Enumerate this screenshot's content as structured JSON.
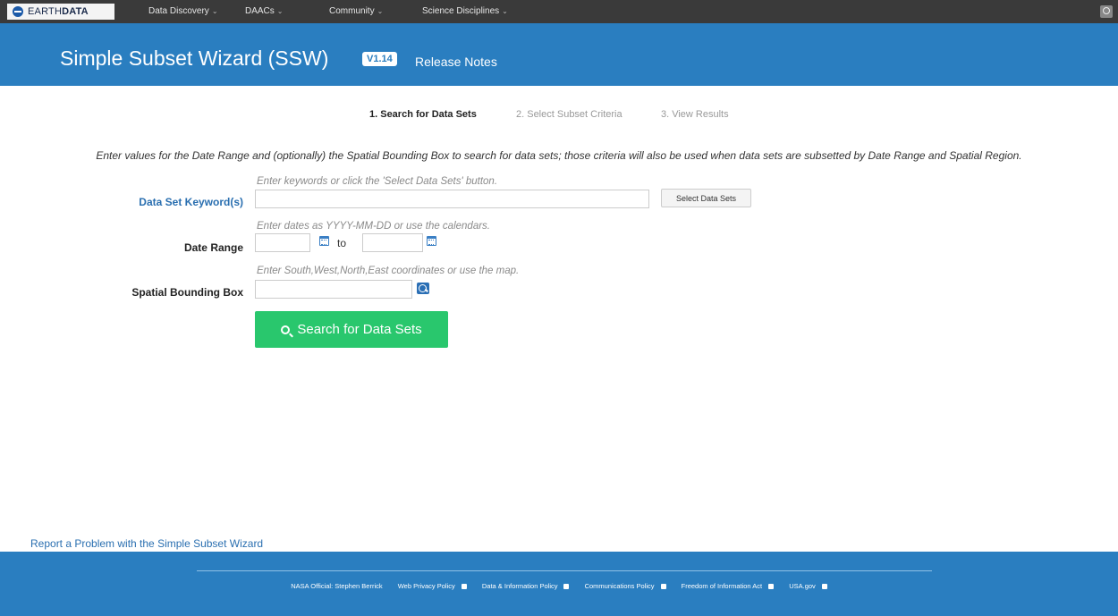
{
  "topnav": {
    "brand_prefix": "EARTH",
    "brand_suffix": "DATA",
    "items": [
      {
        "label": "Data Discovery"
      },
      {
        "label": "DAACs"
      },
      {
        "label": "Community"
      },
      {
        "label": "Science Disciplines"
      }
    ]
  },
  "header": {
    "title": "Simple Subset Wizard (SSW)",
    "version": "V1.14",
    "release_notes": "Release Notes"
  },
  "steps": [
    {
      "label": "1. Search for Data Sets",
      "active": true
    },
    {
      "label": "2. Select Subset Criteria",
      "active": false
    },
    {
      "label": "3. View Results",
      "active": false
    }
  ],
  "intro": "Enter values for the Date Range and (optionally) the Spatial Bounding Box to search for data sets; those criteria will also be used when data sets are subsetted by Date Range and Spatial Region.",
  "form": {
    "keyword": {
      "label": "Data Set Keyword(s)",
      "hint": "Enter keywords or click the 'Select Data Sets' button.",
      "value": "",
      "button": "Select Data Sets"
    },
    "date_range": {
      "label": "Date Range",
      "hint": "Enter dates as YYYY-MM-DD or use the calendars.",
      "start": "",
      "end": "",
      "to": "to"
    },
    "bbox": {
      "label": "Spatial Bounding Box",
      "hint": "Enter South,West,North,East coordinates or use the map.",
      "value": ""
    },
    "search_button": "Search for Data Sets"
  },
  "report_link": "Report a Problem with the Simple Subset Wizard",
  "footer": {
    "official": "NASA Official: Stephen Berrick",
    "links": [
      "Web Privacy Policy",
      "Data & Information Policy",
      "Communications Policy",
      "Freedom of Information Act",
      "USA.gov"
    ]
  },
  "colors": {
    "header_blue": "#2a7ec0",
    "nav_dark": "#3a3a3a",
    "search_green": "#29c76d",
    "link_blue": "#2a6fb0"
  }
}
